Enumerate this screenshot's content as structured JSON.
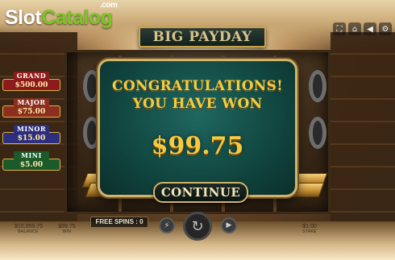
{
  "logo": {
    "part1": "Slot",
    "part2": "Catalog",
    "suffix": ".com"
  },
  "game_title": "BIG PAYDAY",
  "top_icons": [
    "fullscreen-icon",
    "home-icon",
    "sound-icon",
    "settings-icon"
  ],
  "jackpots": [
    {
      "label": "GRAND",
      "value": "$500.00"
    },
    {
      "label": "MAJOR",
      "value": "$75.00"
    },
    {
      "label": "MINOR",
      "value": "$15.00"
    },
    {
      "label": "MINI",
      "value": "$5.00"
    }
  ],
  "dialog": {
    "line1": "CONGRATULATIONS!",
    "line2": "YOU HAVE WON",
    "amount": "$99.75",
    "button": "CONTINUE"
  },
  "bottom": {
    "free_spins": "FREE SPINS : 0",
    "balance_value": "$10,059.75",
    "balance_label": "BALANCE",
    "win_value": "$99.75",
    "win_label": "WIN",
    "stake_value": "$1.00",
    "stake_label": "STAKE"
  },
  "colors": {
    "dialog_bg": "#11453f",
    "dialog_border": "#d3b26a",
    "gold_text": "#f5cc3f",
    "logo_green": "#7bc425"
  }
}
